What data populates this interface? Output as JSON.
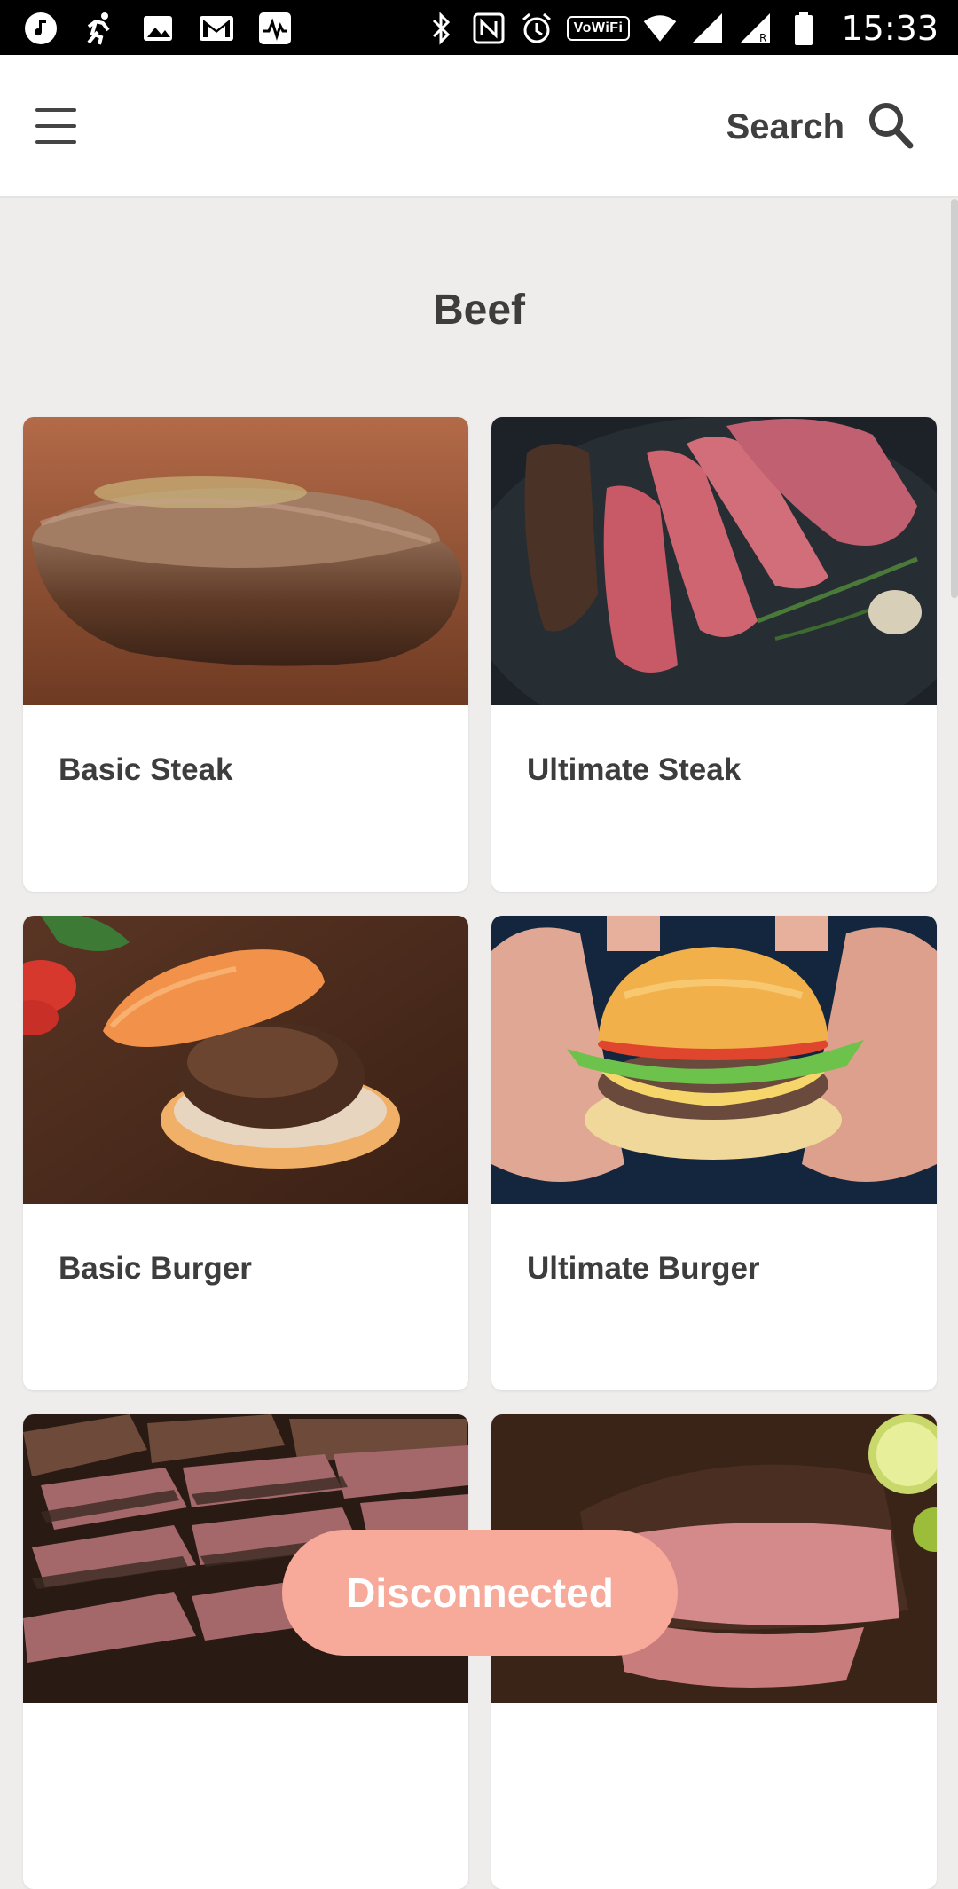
{
  "status_bar": {
    "time": "15:33",
    "volte_label": "VoWiFi",
    "left_icons": [
      "music-icon",
      "fitness-icon",
      "gallery-icon",
      "gmail-icon",
      "activity-icon"
    ],
    "right_icons": [
      "bluetooth-icon",
      "nfc-icon",
      "alarm-icon",
      "wifi-icon",
      "signal-icon",
      "battery-icon"
    ]
  },
  "app_bar": {
    "search_label": "Search"
  },
  "page": {
    "title": "Beef"
  },
  "recipes": [
    {
      "name": "Basic Steak"
    },
    {
      "name": "Ultimate Steak"
    },
    {
      "name": "Basic Burger"
    },
    {
      "name": "Ultimate Burger"
    },
    {
      "name": ""
    },
    {
      "name": ""
    }
  ],
  "toast": {
    "text": "Disconnected"
  },
  "colors": {
    "background": "#eeedec",
    "toast": "#f7a99a",
    "text": "#3d3d3d"
  }
}
